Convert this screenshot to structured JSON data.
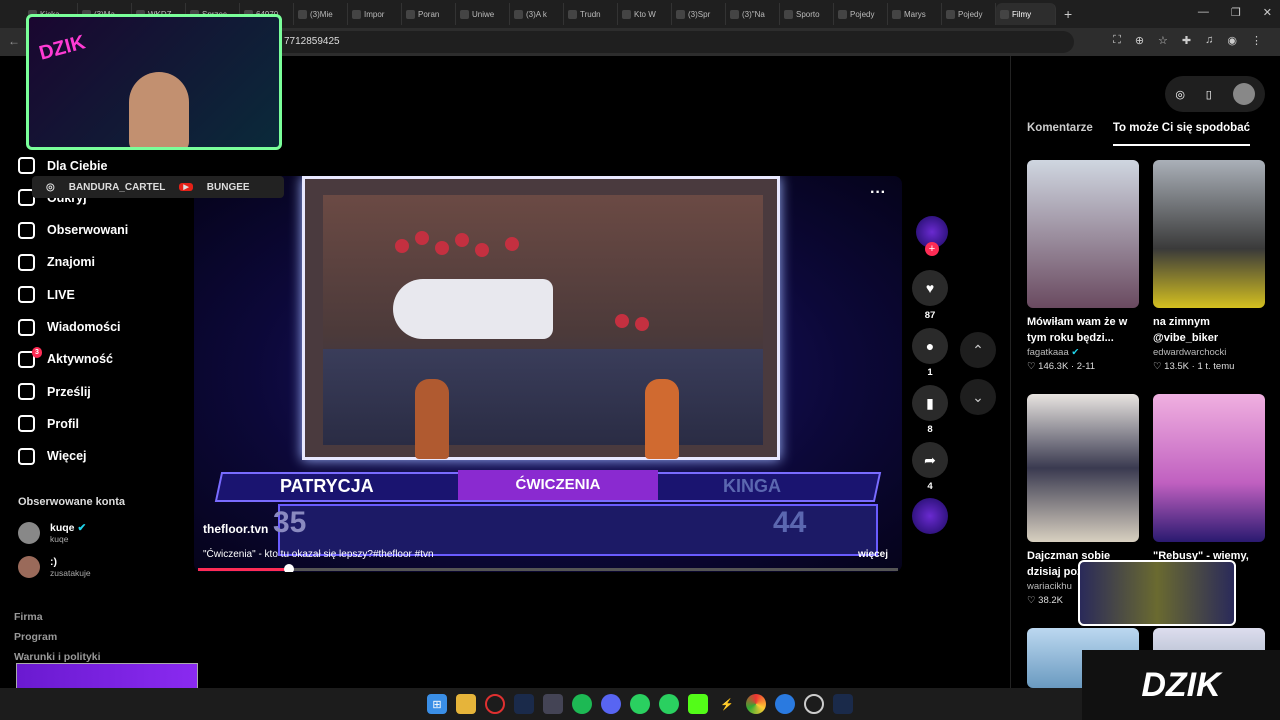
{
  "browser": {
    "tabs": [
      "Kicka",
      "(3)Ma",
      "WKDZ",
      "Sprzec",
      "64970",
      "(3)Mie",
      "Impor",
      "Poran",
      "Uniwe",
      "(3)A k",
      "Trudn",
      "Kto W",
      "(3)Spr",
      "(3)\"Na",
      "Sporto",
      "Pojedy",
      "Marys",
      "Pojedy",
      "Filmy"
    ],
    "active_tab_index": 18,
    "url": "7712859425"
  },
  "sidebar": {
    "items": [
      {
        "label": "Dla Ciebie",
        "icon": "home-icon"
      },
      {
        "label": "Odkryj",
        "icon": "compass-icon"
      },
      {
        "label": "Obserwowani",
        "icon": "following-icon"
      },
      {
        "label": "Znajomi",
        "icon": "friends-icon"
      },
      {
        "label": "LIVE",
        "icon": "live-icon"
      },
      {
        "label": "Wiadomości",
        "icon": "messages-icon"
      },
      {
        "label": "Aktywność",
        "icon": "activity-icon",
        "badge": "3"
      },
      {
        "label": "Prześlij",
        "icon": "upload-icon"
      },
      {
        "label": "Profil",
        "icon": "profile-icon"
      },
      {
        "label": "Więcej",
        "icon": "more-icon"
      }
    ],
    "followed_title": "Obserwowane konta",
    "followed": [
      {
        "name": "kuqe",
        "handle": "kuqe",
        "verified": true
      },
      {
        "name": ":)",
        "handle": "zusatakuje"
      }
    ],
    "footer": [
      "Firma",
      "Program",
      "Warunki i polityki"
    ]
  },
  "video": {
    "author": "thefloor.tvn",
    "caption": "\"Ćwiczenia\" - kto tu okazał się lepszy?#thefloor #tvn",
    "more": "więcej",
    "scoreboard": {
      "left_name": "PATRYCJA",
      "category": "ĆWICZENIA",
      "right_name": "KINGA",
      "left_score": "35",
      "right_score": "44"
    },
    "progress": 0.13
  },
  "actions": {
    "likes": "87",
    "comments": "1",
    "saves": "8",
    "shares": "4"
  },
  "right_panel": {
    "tabs": [
      "Komentarze",
      "To może Ci się spodobać"
    ],
    "active_tab": 1,
    "cards": [
      {
        "title": "Mówiłam wam że w tym roku będzi...",
        "author": "fagatkaaa",
        "verified": true,
        "likes": "146.3K",
        "date": "2-11"
      },
      {
        "title": "na zimnym @vibe_biker",
        "author": "edwardwarchocki",
        "likes": "13.5K",
        "date": "1 t. temu"
      },
      {
        "title": "Dajczman sobie dzisiaj poz...",
        "author": "wariacikhu",
        "likes": "38.2K",
        "date": ""
      },
      {
        "title": "\"Rebusy\" - wiemy,",
        "author": "",
        "likes": "",
        "date": ""
      }
    ]
  },
  "overlay": {
    "handle_ig": "BANDURA_CARTEL",
    "handle_yt": "BUNGEE",
    "brand": "DZIK",
    "cam_logo": "DZIK"
  }
}
